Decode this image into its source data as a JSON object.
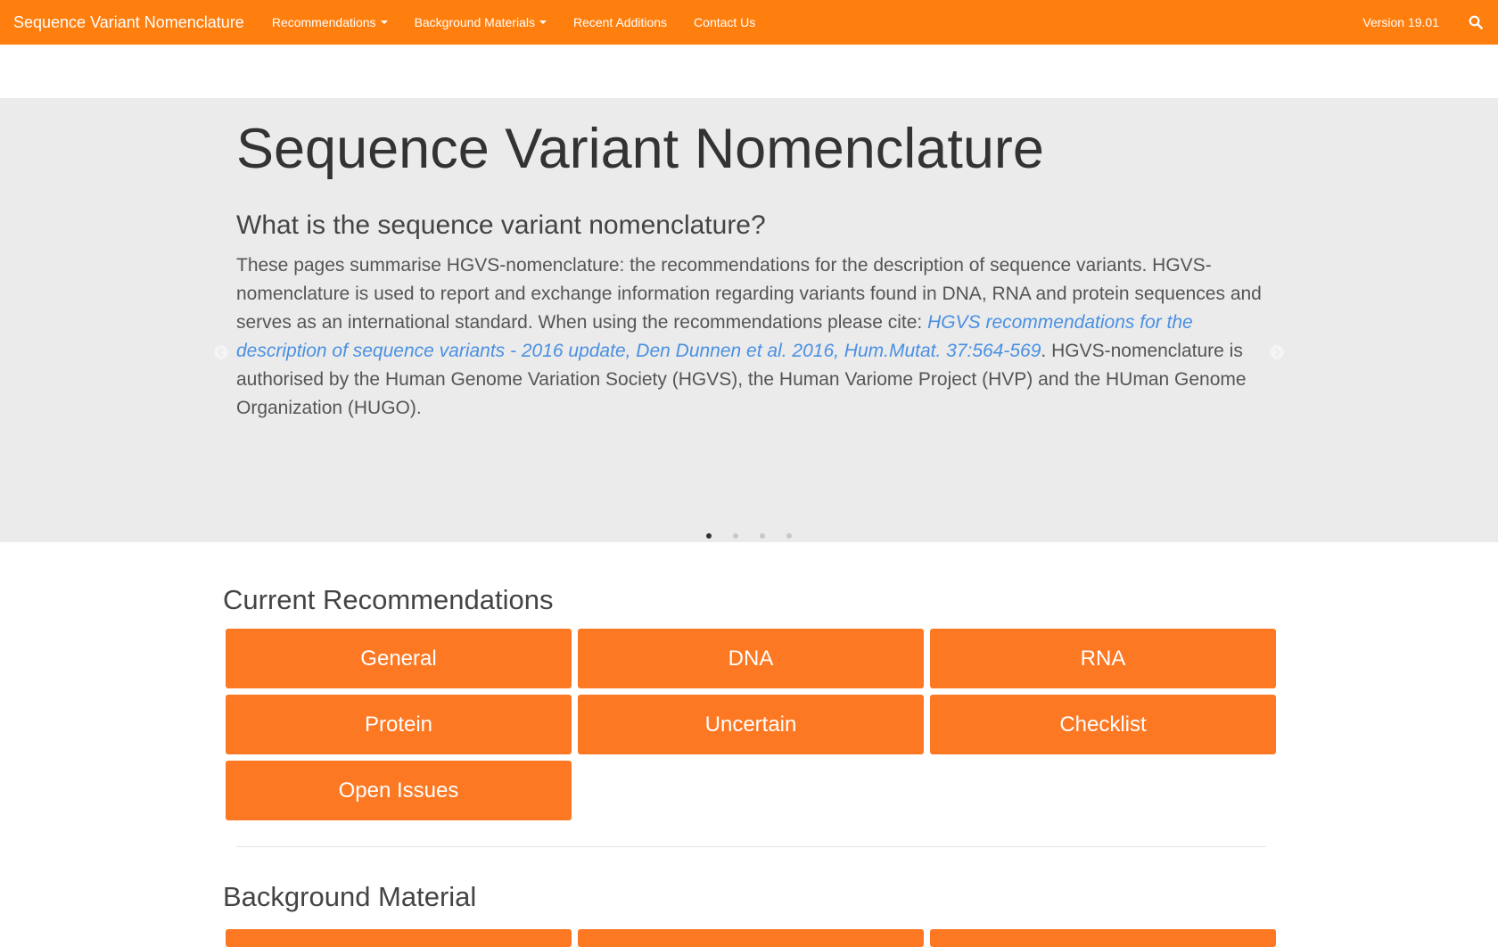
{
  "navbar": {
    "brand": "Sequence Variant Nomenclature",
    "items": [
      {
        "label": "Recommendations",
        "dropdown": true
      },
      {
        "label": "Background Materials",
        "dropdown": true
      },
      {
        "label": "Recent Additions",
        "dropdown": false
      },
      {
        "label": "Contact Us",
        "dropdown": false
      }
    ],
    "version": "Version 19.01",
    "search_icon": "search-icon"
  },
  "hero": {
    "title": "Sequence Variant Nomenclature",
    "subtitle": "What is the sequence variant nomenclature?",
    "text_before": "These pages summarise HGVS-nomenclature: the recommendations for the description of sequence variants. HGVS-nomenclature is used to report and exchange information regarding variants found in DNA, RNA and protein sequences and serves as an international standard. When using the recommendations please cite: ",
    "link": "HGVS recommendations for the description of sequence variants - 2016 update, Den Dunnen et al. 2016, Hum.Mutat. 37:564-569",
    "text_after": ". HGVS-nomenclature is authorised by the Human Genome Variation Society (HGVS), the Human Variome Project (HVP) and the HUman Genome Organization (HUGO).",
    "prev_icon": "chevron-left-icon",
    "next_icon": "chevron-right-icon",
    "slides": 4,
    "active_slide": 1
  },
  "recommendations": {
    "title": "Current Recommendations",
    "buttons": [
      "General",
      "DNA",
      "RNA",
      "Protein",
      "Uncertain",
      "Checklist",
      "Open Issues"
    ]
  },
  "background": {
    "title": "Background Material"
  },
  "colors": {
    "navbar": "#ff7f0e",
    "button": "#fd7823",
    "hero_bg": "#ebebeb",
    "link": "#4a90e2"
  }
}
